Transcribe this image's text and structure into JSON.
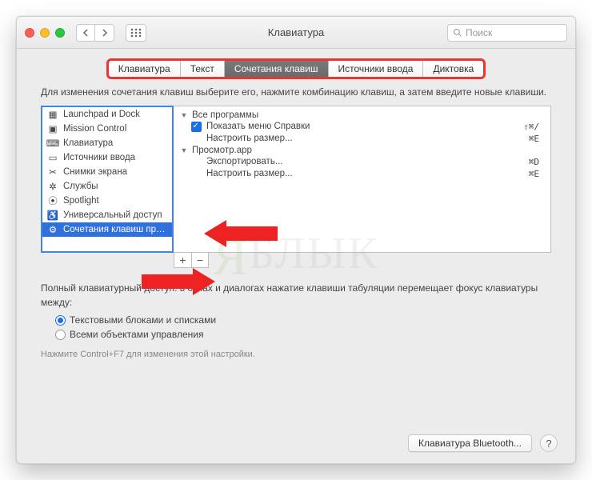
{
  "window": {
    "title": "Клавиатура"
  },
  "search": {
    "placeholder": "Поиск"
  },
  "tabs": [
    {
      "label": "Клавиатура"
    },
    {
      "label": "Текст"
    },
    {
      "label": "Сочетания клавиш",
      "active": true
    },
    {
      "label": "Источники ввода"
    },
    {
      "label": "Диктовка"
    }
  ],
  "help_text": "Для изменения сочетания клавиш выберите его, нажмите комбинацию клавиш, а затем введите новые клавиши.",
  "categories": [
    {
      "label": "Launchpad и Dock",
      "icon": "launchpad"
    },
    {
      "label": "Mission Control",
      "icon": "mission"
    },
    {
      "label": "Клавиатура",
      "icon": "keyboard"
    },
    {
      "label": "Источники ввода",
      "icon": "input"
    },
    {
      "label": "Снимки экрана",
      "icon": "screenshot"
    },
    {
      "label": "Службы",
      "icon": "services"
    },
    {
      "label": "Spotlight",
      "icon": "spotlight"
    },
    {
      "label": "Универсальный доступ",
      "icon": "accessibility"
    },
    {
      "label": "Сочетания клавиш пр…",
      "icon": "appshortcut",
      "selected": true
    }
  ],
  "shortcuts": {
    "groups": [
      {
        "name": "Все программы",
        "items": [
          {
            "checked": true,
            "label": "Показать меню Справки",
            "keys": "⇧⌘/"
          },
          {
            "checked": false,
            "label": "Настроить размер...",
            "keys": "⌘E"
          }
        ]
      },
      {
        "name": "Просмотр.app",
        "items": [
          {
            "checked": false,
            "label": "Экспортировать...",
            "keys": "⌘D"
          },
          {
            "checked": false,
            "label": "Настроить размер...",
            "keys": "⌘E"
          }
        ]
      }
    ]
  },
  "buttons": {
    "plus": "+",
    "minus": "−"
  },
  "fka": {
    "intro": "Полный клавиатурный доступ: в окнах и диалогах нажатие клавиши табуляции перемещает фокус клавиатуры между:",
    "opt1": "Текстовыми блоками и списками",
    "opt2": "Всеми объектами управления",
    "hint": "Нажмите Control+F7 для изменения этой настройки."
  },
  "footer": {
    "bluetooth": "Клавиатура Bluetooth...",
    "help": "?"
  },
  "watermark": "ЯБЛЫК"
}
